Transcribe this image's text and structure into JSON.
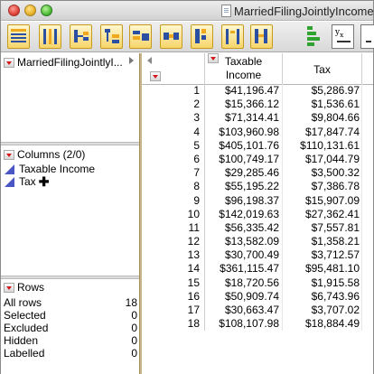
{
  "window": {
    "title": "MarriedFilingJointlyIncome"
  },
  "toolbar": {
    "buttons": [
      "table-tool-icon",
      "columns-tool-icon",
      "split-icon",
      "tree-icon",
      "stack-icon",
      "join-icon",
      "sort-icon",
      "transpose-icon",
      "concatenate-icon",
      "chart-icon",
      "formula-icon",
      "window-icon"
    ]
  },
  "left_panel": {
    "table_name": "MarriedFilingJointlyI...",
    "columns_header": "Columns (2/0)",
    "columns": [
      {
        "name": "Taxable Income"
      },
      {
        "name": "Tax",
        "marker": "✚"
      }
    ],
    "rows_header": "Rows",
    "rows_summary": [
      {
        "label": "All rows",
        "value": "18"
      },
      {
        "label": "Selected",
        "value": "0"
      },
      {
        "label": "Excluded",
        "value": "0"
      },
      {
        "label": "Hidden",
        "value": "0"
      },
      {
        "label": "Labelled",
        "value": "0"
      }
    ]
  },
  "grid": {
    "headers": {
      "col1_line1": "Taxable",
      "col1_line2": "Income",
      "col2": "Tax"
    },
    "rows": [
      {
        "n": "1",
        "income": "$41,196.47",
        "tax": "$5,286.97"
      },
      {
        "n": "2",
        "income": "$15,366.12",
        "tax": "$1,536.61"
      },
      {
        "n": "3",
        "income": "$71,314.41",
        "tax": "$9,804.66"
      },
      {
        "n": "4",
        "income": "$103,960.98",
        "tax": "$17,847.74"
      },
      {
        "n": "5",
        "income": "$405,101.76",
        "tax": "$110,131.61"
      },
      {
        "n": "6",
        "income": "$100,749.17",
        "tax": "$17,044.79"
      },
      {
        "n": "7",
        "income": "$29,285.46",
        "tax": "$3,500.32"
      },
      {
        "n": "8",
        "income": "$55,195.22",
        "tax": "$7,386.78"
      },
      {
        "n": "9",
        "income": "$96,198.37",
        "tax": "$15,907.09"
      },
      {
        "n": "10",
        "income": "$142,019.63",
        "tax": "$27,362.41"
      },
      {
        "n": "11",
        "income": "$56,335.42",
        "tax": "$7,557.81"
      },
      {
        "n": "12",
        "income": "$13,582.09",
        "tax": "$1,358.21"
      },
      {
        "n": "13",
        "income": "$30,700.49",
        "tax": "$3,712.57"
      },
      {
        "n": "14",
        "income": "$361,115.47",
        "tax": "$95,481.10"
      },
      {
        "n": "15",
        "income": "$18,720.56",
        "tax": "$1,915.58"
      },
      {
        "n": "16",
        "income": "$50,909.74",
        "tax": "$6,743.96"
      },
      {
        "n": "17",
        "income": "$30,663.47",
        "tax": "$3,707.02"
      },
      {
        "n": "18",
        "income": "$108,107.98",
        "tax": "$18,884.49"
      }
    ]
  },
  "colors": {
    "continuous_icon": "#4a56c4",
    "menu_triangle": "#d2191c",
    "splitter": "#c9b58a"
  }
}
